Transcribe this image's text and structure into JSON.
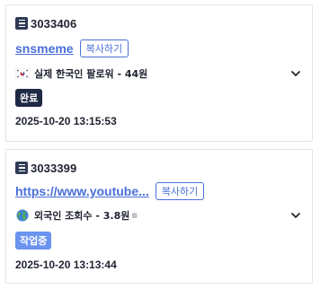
{
  "colors": {
    "accent": "#4a6fd8",
    "status_done": "#1f2a44",
    "status_working": "#6b93f0",
    "text": "#1f2430",
    "border": "#dfe3e8"
  },
  "orders": [
    {
      "id": "3033406",
      "link": "snsmeme",
      "copy_label": "복사하기",
      "flag_icon": "south-korea-flag-icon",
      "service": "실제 한국인 팔로워 - 44원",
      "status": "완료",
      "timestamp": "2025-10-20 13:15:53"
    },
    {
      "id": "3033399",
      "link": "https://www.youtube...",
      "copy_label": "복사하기",
      "flag_icon": "globe-icon",
      "service": "외국인 조회수 - 3.8원",
      "status": "작업중",
      "timestamp": "2025-10-20 13:13:44"
    }
  ]
}
